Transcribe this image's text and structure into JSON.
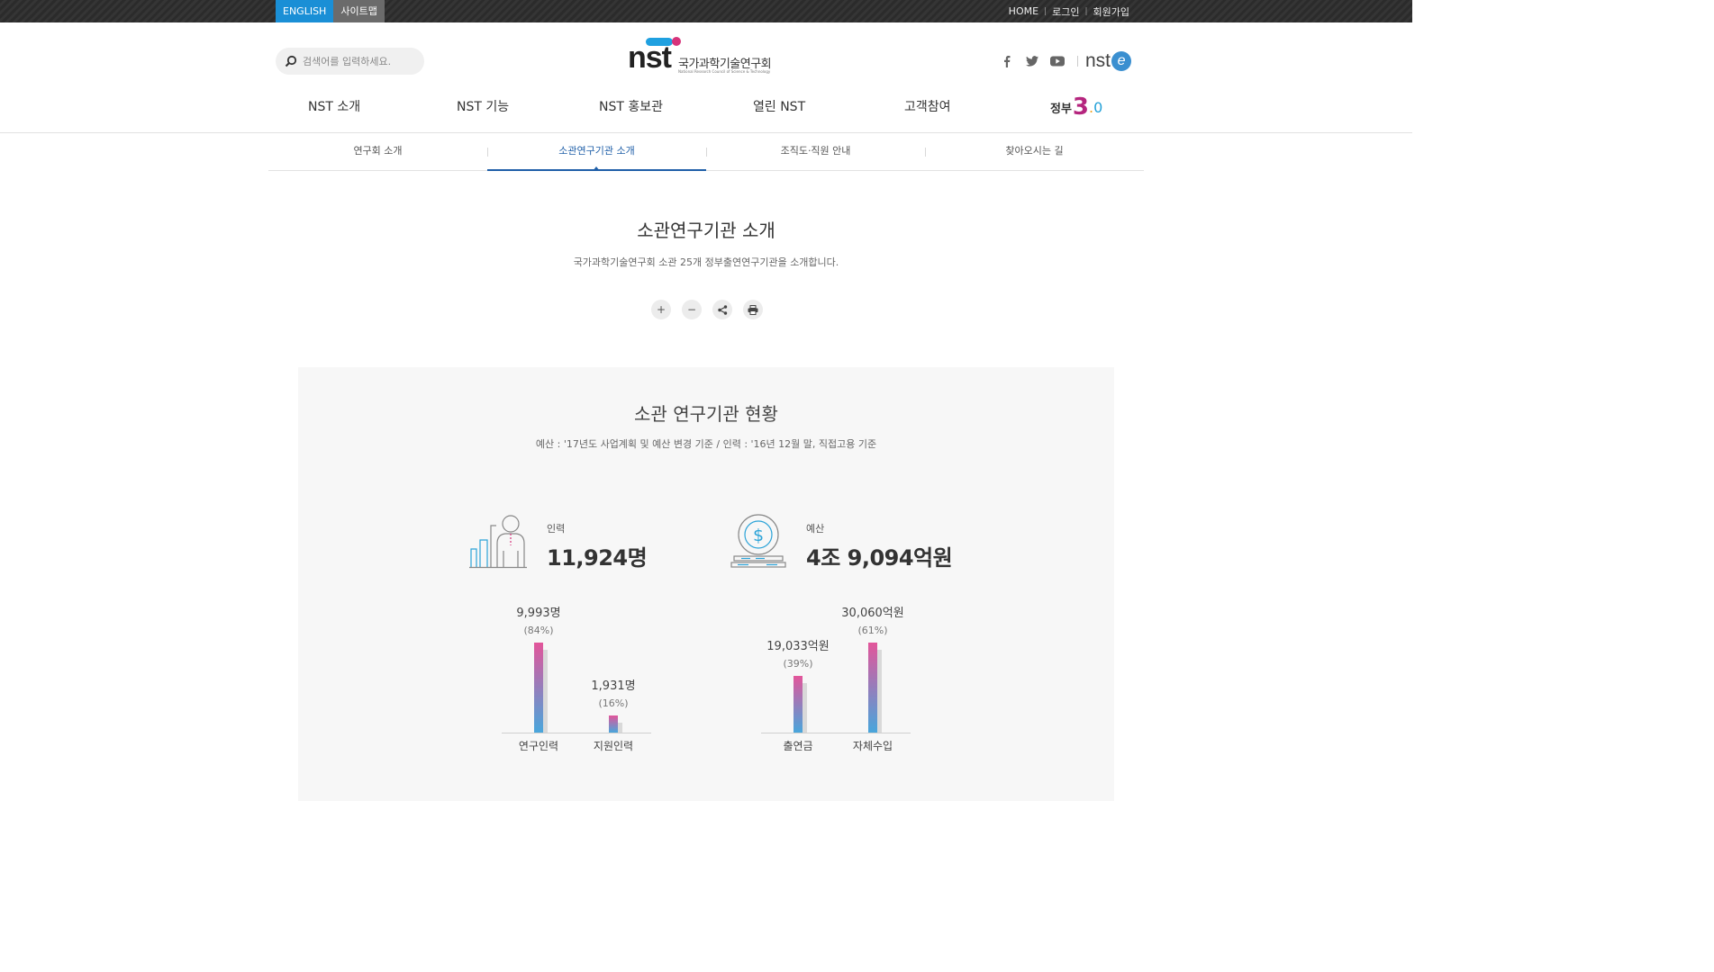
{
  "topbar": {
    "english": "ENGLISH",
    "sitemap": "사이트맵",
    "home": "HOME",
    "login": "로그인",
    "join": "회원가입",
    "sep": "|"
  },
  "header": {
    "search_placeholder": "검색어를 입력하세요.",
    "logo_text": "nst",
    "logo_korean": "국가과학기술연구회",
    "logo_english": "National Research Council of Science & Technology",
    "social": [
      "f",
      "twitter",
      "youtube"
    ],
    "nste_label": "nst",
    "nste_e": "e"
  },
  "gnb": {
    "items": [
      "NST 소개",
      "NST 기능",
      "NST 홍보관",
      "열린 NST",
      "고객참여"
    ],
    "gov_text": "정부",
    "gov_num": "3",
    "gov_dot": ".",
    "gov_zero": "0"
  },
  "subnav": {
    "tabs": [
      "연구회 소개",
      "소관연구기관 소개",
      "조직도·직원 안내",
      "찾아오시는 길"
    ],
    "active_index": 1
  },
  "page": {
    "title": "소관연구기관 소개",
    "description": "국가과학기술연구회 소관 25개 정부출연연구기관을 소개합니다.",
    "tools": [
      "+",
      "−",
      "share-icon",
      "print-icon"
    ]
  },
  "stats": {
    "title": "소관 연구기관 현황",
    "description": "예산 : '17년도 사업계획 및 예산 변경 기준 / 인력 : '16년 12월 말, 직접고용 기준",
    "personnel": {
      "label": "인력",
      "value": "11,924명"
    },
    "budget": {
      "label": "예산",
      "value": "4조 9,094억원"
    }
  },
  "chart_data": [
    {
      "type": "bar",
      "categories": [
        "연구인력",
        "지원인력"
      ],
      "values": [
        9993,
        1931
      ],
      "value_labels": [
        "9,993명",
        "1,931명"
      ],
      "percent_labels": [
        "(84%)",
        "(16%)"
      ],
      "unit": "명"
    },
    {
      "type": "bar",
      "categories": [
        "출연금",
        "자체수입"
      ],
      "values": [
        19033,
        30060
      ],
      "value_labels": [
        "19,033억원",
        "30,060억원"
      ],
      "percent_labels": [
        "(39%)",
        "(61%)"
      ],
      "unit": "억원"
    }
  ],
  "colors": {
    "accent": "#1a8fd6",
    "active_tab": "#1f5fa8",
    "bar_top": "#e3559a",
    "bar_bottom": "#48a6dc"
  }
}
